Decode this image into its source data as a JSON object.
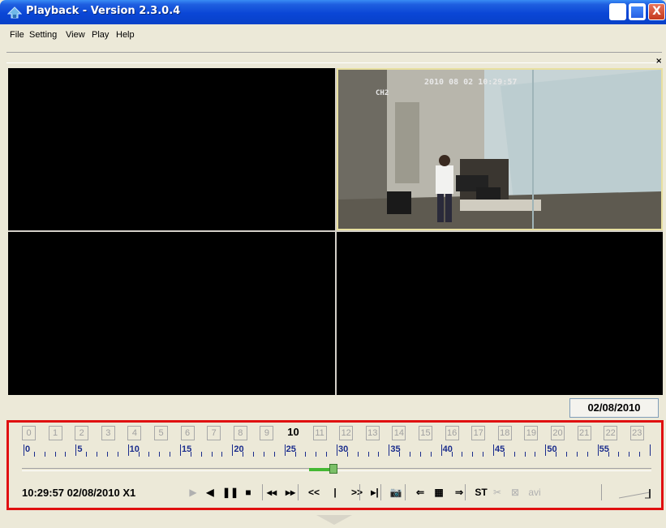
{
  "window": {
    "title": "Playback - Version 2.3.0.4",
    "close_glyph": "X"
  },
  "menu": {
    "items": [
      {
        "label": "File",
        "key": "F"
      },
      {
        "label": "Setting",
        "key": "S"
      },
      {
        "label": "View",
        "key": "V"
      },
      {
        "label": "Play",
        "key": "P"
      },
      {
        "label": "Help",
        "key": "H"
      }
    ]
  },
  "toolstrip": {
    "close_glyph": "×"
  },
  "video": {
    "panes": [
      {
        "id": "pane-1",
        "active": false,
        "content": "empty"
      },
      {
        "id": "pane-2",
        "active": true,
        "content": "camera",
        "osd_time": "2010 08 02 10:29:57",
        "osd_channel": "CH2"
      },
      {
        "id": "pane-3",
        "active": false,
        "content": "empty"
      },
      {
        "id": "pane-4",
        "active": false,
        "content": "empty"
      }
    ]
  },
  "date_button": "02/08/2010",
  "timeline": {
    "hours": [
      "0",
      "1",
      "2",
      "3",
      "4",
      "5",
      "6",
      "7",
      "8",
      "9",
      "10",
      "11",
      "12",
      "13",
      "14",
      "15",
      "16",
      "17",
      "18",
      "19",
      "20",
      "21",
      "22",
      "23"
    ],
    "active_hour": "10",
    "minute_labels": [
      "0",
      "5",
      "10",
      "15",
      "20",
      "25",
      "30",
      "35",
      "40",
      "45",
      "50",
      "55"
    ],
    "position_fraction": 0.495
  },
  "status": {
    "time_text": "10:29:57 02/08/2010 X1"
  },
  "controls": [
    {
      "name": "play-button",
      "label": "▶",
      "dim": true
    },
    {
      "name": "reverse-play-button",
      "label": "◀",
      "dim": false
    },
    {
      "name": "pause-button",
      "label": "❚❚",
      "dim": false
    },
    {
      "name": "stop-button",
      "label": "■",
      "dim": false
    },
    {
      "name": "slow-button",
      "label": "◂◂",
      "dim": false
    },
    {
      "name": "fast-button",
      "label": "▸▸",
      "dim": false
    },
    {
      "name": "prev-segment-button",
      "label": "<<",
      "dim": false
    },
    {
      "name": "marker-button",
      "label": "|",
      "dim": false
    },
    {
      "name": "next-segment-button",
      "label": ">>",
      "dim": false
    },
    {
      "name": "step-button",
      "label": "▸|",
      "dim": false
    },
    {
      "name": "snapshot-button",
      "label": "📷",
      "dim": false
    },
    {
      "name": "prev-frame-button",
      "label": "⇐",
      "dim": false
    },
    {
      "name": "grid-button",
      "label": "▦",
      "dim": false
    },
    {
      "name": "next-frame-button",
      "label": "⇒",
      "dim": false
    },
    {
      "name": "st-button",
      "label": "ST",
      "dim": false
    },
    {
      "name": "cut-button",
      "label": "✂",
      "dim": true
    },
    {
      "name": "clear-button",
      "label": "⊠",
      "dim": true
    },
    {
      "name": "avi-button",
      "label": "avi",
      "dim": true
    }
  ],
  "colors": {
    "title_blue": "#0A46D6",
    "highlight_red": "#E01010",
    "minute_blue": "#1A2C8C",
    "slider_green": "#44B833"
  }
}
